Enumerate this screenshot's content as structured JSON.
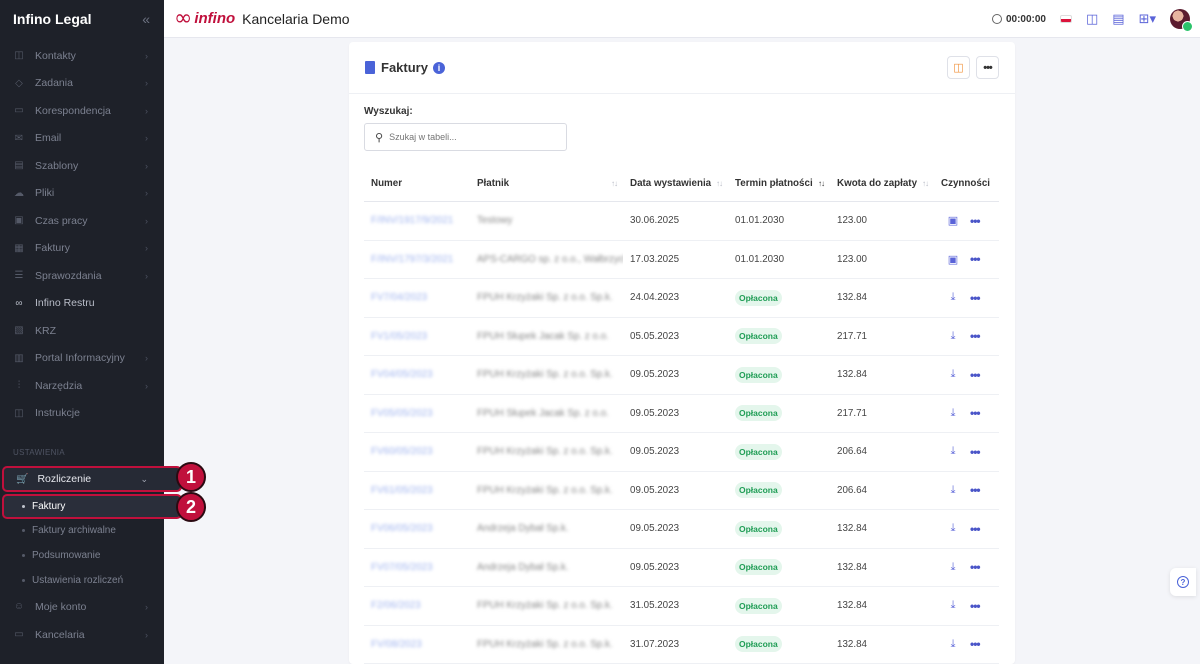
{
  "sidebar": {
    "title": "Infino Legal",
    "collapse_icon": "collapse-icon",
    "items": [
      {
        "label": "Kontakty",
        "icon": "contacts-icon",
        "glyph": "◫"
      },
      {
        "label": "Zadania",
        "icon": "tasks-icon",
        "glyph": "◇"
      },
      {
        "label": "Korespondencja",
        "icon": "mail-icon",
        "glyph": "▭"
      },
      {
        "label": "Email",
        "icon": "email-icon",
        "glyph": "✉"
      },
      {
        "label": "Szablony",
        "icon": "templates-icon",
        "glyph": "▤"
      },
      {
        "label": "Pliki",
        "icon": "cloud-icon",
        "glyph": "☁"
      },
      {
        "label": "Czas pracy",
        "icon": "clock-icon",
        "glyph": "▣"
      },
      {
        "label": "Faktury",
        "icon": "invoice-icon",
        "glyph": "▦"
      },
      {
        "label": "Sprawozdania",
        "icon": "list-icon",
        "glyph": "☰"
      },
      {
        "label": "Infino Restru",
        "icon": "infinity-icon",
        "glyph": "∞"
      },
      {
        "label": "KRZ",
        "icon": "krz-icon",
        "glyph": "▧"
      },
      {
        "label": "Portal Informacyjny",
        "icon": "portal-icon",
        "glyph": "▥"
      },
      {
        "label": "Narzędzia",
        "icon": "tools-icon",
        "glyph": "⫶"
      },
      {
        "label": "Instrukcje",
        "icon": "book-icon",
        "glyph": "◫"
      }
    ],
    "section_label": "USTAWIENIA",
    "active_parent": {
      "label": "Rozliczenie",
      "icon": "billing-icon"
    },
    "active_sub": "Faktury",
    "subs": [
      "Faktury archiwalne",
      "Podsumowanie",
      "Ustawienia rozliczeń"
    ],
    "bottom": [
      {
        "label": "Moje konto",
        "icon": "user-icon",
        "glyph": "☺"
      },
      {
        "label": "Kancelaria",
        "icon": "office-icon",
        "glyph": "▭"
      }
    ],
    "badges": [
      "1",
      "2"
    ]
  },
  "topbar": {
    "logo_text": "infino",
    "office_name": "Kancelaria Demo",
    "timer": "00:00:00"
  },
  "card": {
    "title": "Faktury",
    "search_label": "Wyszukaj:",
    "search_placeholder": "Szukaj w tabeli..."
  },
  "table": {
    "headers": [
      "Numer",
      "Płatnik",
      "Data wystawienia",
      "Termin płatności",
      "Kwota do zapłaty",
      "Czynności"
    ],
    "rows": [
      {
        "numer": "F/INV/1917/9/2021",
        "platnik": "Testowy",
        "data": "30.06.2025",
        "termin": "01.01.2030",
        "kwota": "123.00",
        "icon": "money-icon"
      },
      {
        "numer": "F/INV/1797/3/2021",
        "platnik": "APS-CARGO sp. z o.o., Wałbrzych",
        "data": "17.03.2025",
        "termin": "01.01.2030",
        "kwota": "123.00",
        "icon": "money-icon"
      },
      {
        "numer": "FV7/04/2023",
        "platnik": "FPUH Krzyżaki Sp. z o.o. Sp.k.",
        "data": "24.04.2023",
        "termin": "Opłacona",
        "kwota": "132.84",
        "icon": "download-icon"
      },
      {
        "numer": "FV1/05/2023",
        "platnik": "FPUH Słupek Jacak Sp. z o.o.",
        "data": "05.05.2023",
        "termin": "Opłacona",
        "kwota": "217.71",
        "icon": "download-icon"
      },
      {
        "numer": "FV04/05/2023",
        "platnik": "FPUH Krzyżaki Sp. z o.o. Sp.k.",
        "data": "09.05.2023",
        "termin": "Opłacona",
        "kwota": "132.84",
        "icon": "download-icon"
      },
      {
        "numer": "FV05/05/2023",
        "platnik": "FPUH Słupek Jacak Sp. z o.o.",
        "data": "09.05.2023",
        "termin": "Opłacona",
        "kwota": "217.71",
        "icon": "download-icon"
      },
      {
        "numer": "FV60/05/2023",
        "platnik": "FPUH Krzyżaki Sp. z o.o. Sp.k.",
        "data": "09.05.2023",
        "termin": "Opłacona",
        "kwota": "206.64",
        "icon": "download-icon"
      },
      {
        "numer": "FV61/05/2023",
        "platnik": "FPUH Krzyżaki Sp. z o.o. Sp.k.",
        "data": "09.05.2023",
        "termin": "Opłacona",
        "kwota": "206.64",
        "icon": "download-icon"
      },
      {
        "numer": "FV06/05/2023",
        "platnik": "Andrzeja Dybał Sp.k.",
        "data": "09.05.2023",
        "termin": "Opłacona",
        "kwota": "132.84",
        "icon": "download-icon"
      },
      {
        "numer": "FV07/05/2023",
        "platnik": "Andrzeja Dybał Sp.k.",
        "data": "09.05.2023",
        "termin": "Opłacona",
        "kwota": "132.84",
        "icon": "download-icon"
      },
      {
        "numer": "F2/06/2023",
        "platnik": "FPUH Krzyżaki Sp. z o.o. Sp.k.",
        "data": "31.05.2023",
        "termin": "Opłacona",
        "kwota": "132.84",
        "icon": "download-icon"
      },
      {
        "numer": "FV/08/2023",
        "platnik": "FPUH Krzyżaki Sp. z o.o. Sp.k.",
        "data": "31.07.2023",
        "termin": "Opłacona",
        "kwota": "132.84",
        "icon": "download-icon"
      }
    ]
  },
  "colors": {
    "brand": "#c0103c",
    "accent": "#4a63d8",
    "paid_bg": "#e4f6ec",
    "paid_text": "#1f9d55"
  }
}
